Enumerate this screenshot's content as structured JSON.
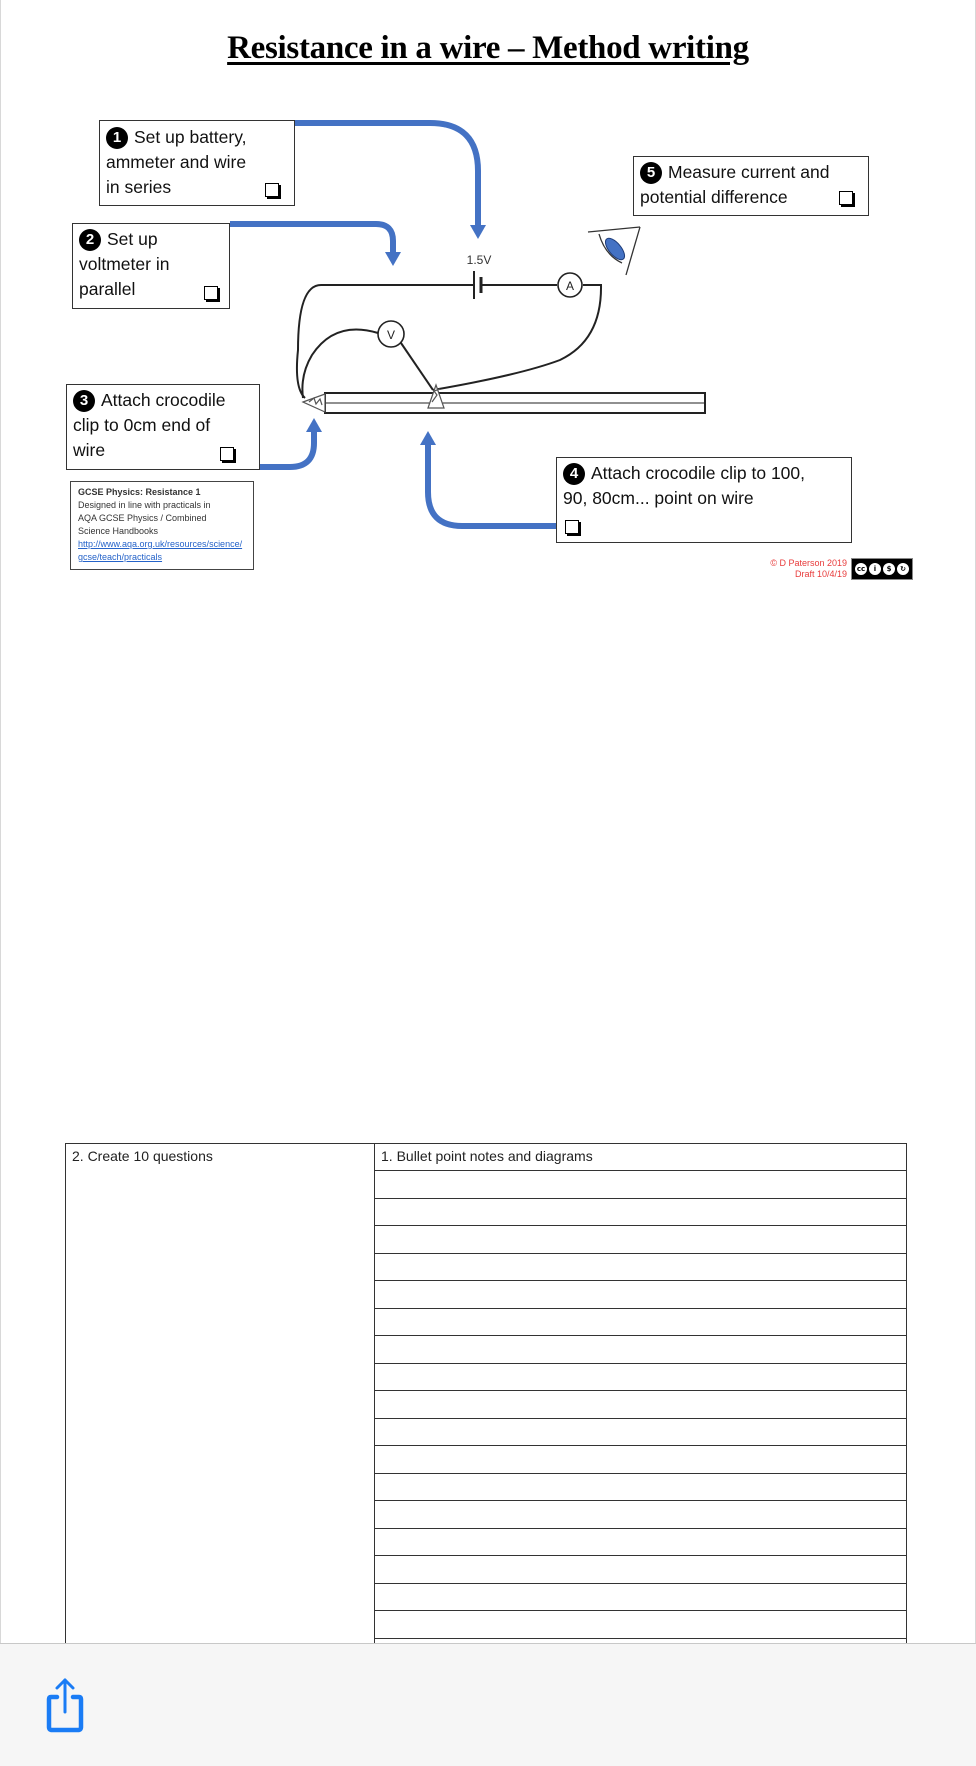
{
  "document": {
    "title": "Resistance in a wire – Method writing",
    "steps": [
      {
        "number": "1",
        "lines": [
          "Set up battery,",
          "ammeter and wire",
          "in series"
        ],
        "checked": false
      },
      {
        "number": "2",
        "lines": [
          "Set up",
          "voltmeter in",
          "parallel"
        ],
        "checked": false
      },
      {
        "number": "3",
        "lines": [
          "Attach crocodile",
          "clip to 0cm end of",
          "wire"
        ],
        "checked": false
      },
      {
        "number": "4",
        "lines": [
          "Attach crocodile clip to 100,",
          "90, 80cm... point on wire"
        ],
        "checked": false
      },
      {
        "number": "5",
        "lines": [
          "Measure current and",
          "potential difference"
        ],
        "checked": false
      }
    ],
    "circuit": {
      "battery_label": "1.5V",
      "ammeter_label": "A",
      "voltmeter_label": "V",
      "arrow_color": "#4472c4",
      "eye_color": "#4472c4"
    },
    "info_box": {
      "heading": "GCSE Physics: Resistance 1",
      "line1": "Designed in line with practicals in",
      "line2": "AQA GCSE Physics / Combined",
      "line3": "Science Handbooks",
      "link": "http://www.aqa.org.uk/resources/science/gcse/teach/practicals"
    },
    "copyright": {
      "line1": "© D Paterson 2019",
      "line2": "Draft 10/4/19",
      "license_badge": [
        "cc",
        "by",
        "nc",
        "sa"
      ],
      "color": "#e83b3b"
    },
    "notes_table": {
      "left_header": "2. Create 10 questions",
      "right_header": "1. Bullet point notes and diagrams",
      "visible_ruled_lines": 17
    }
  },
  "toolbar": {
    "share_icon": "share-icon",
    "accent": "#1a7cf5"
  }
}
